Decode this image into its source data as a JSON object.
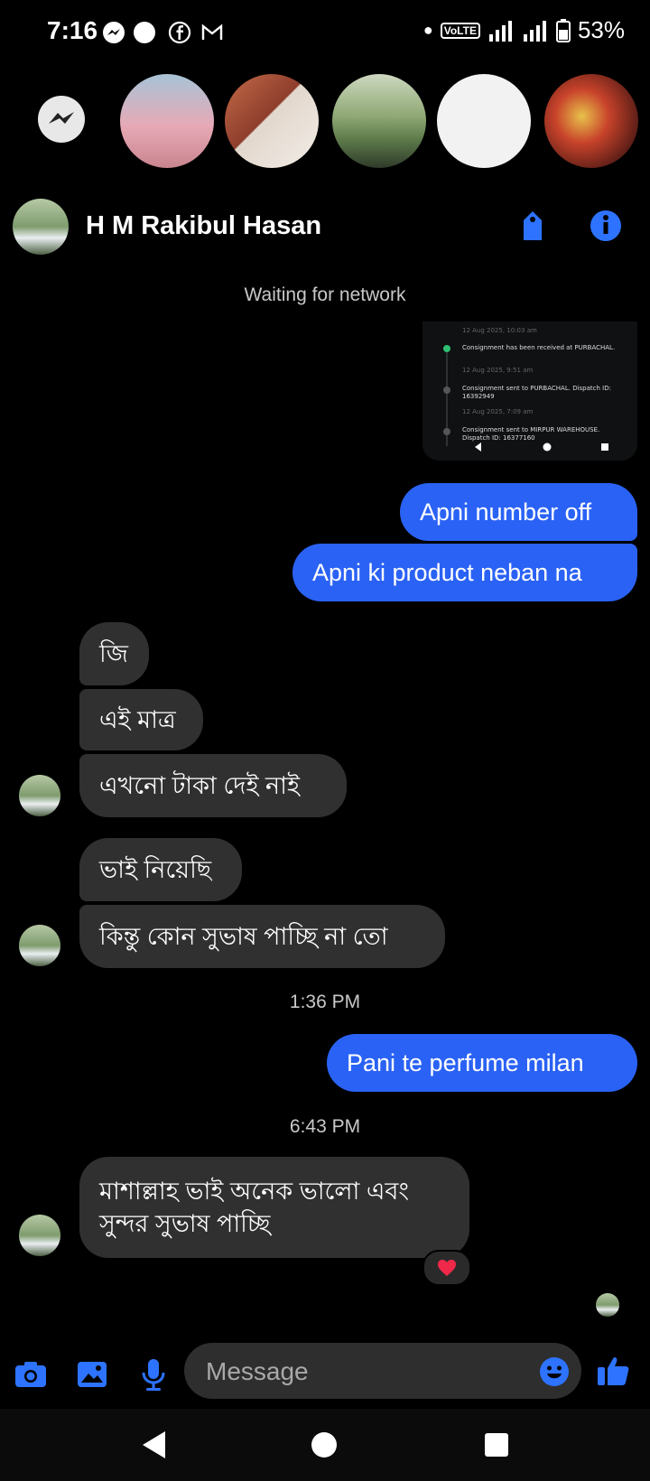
{
  "status_bar": {
    "time": "7:16",
    "battery": "53%",
    "network_label": "VoLTE"
  },
  "header": {
    "contact_name": "H M Rakibul Hasan"
  },
  "network_notice": "Waiting for network",
  "shared_screenshot": {
    "lines": [
      "12 Aug 2025, 10:03 am",
      "Consignment has been received at PURBACHAL.",
      "12 Aug 2025, 9:51 am",
      "Consignment sent to PURBACHAL. Dispatch ID: 16392949",
      "12 Aug 2025, 7:09 am",
      "Consignment sent to MIRPUR WAREHOUSE. Dispatch ID: 16377160"
    ]
  },
  "messages": {
    "m1": "Apni number off",
    "m2": "Apni ki product neban na",
    "m3": "জি",
    "m4": "এই মাত্র",
    "m5": "এখনো টাকা দেই নাই",
    "m6": "ভাই নিয়েছি",
    "m7": "কিন্তু কোন সুভাষ পাচ্ছি না তো",
    "t1": "1:36 PM",
    "m8": "Pani te perfume milan",
    "t2": "6:43 PM",
    "m9a": "মাশাল্লাহ ভাই অনেক ভালো এবং",
    "m9b": "সুন্দর সুভাষ পাচ্ছি"
  },
  "reaction": "❤️",
  "composer": {
    "placeholder": "Message"
  },
  "colors": {
    "accent": "#2a62f5",
    "incoming_bubble": "#303030",
    "background": "#000000"
  }
}
